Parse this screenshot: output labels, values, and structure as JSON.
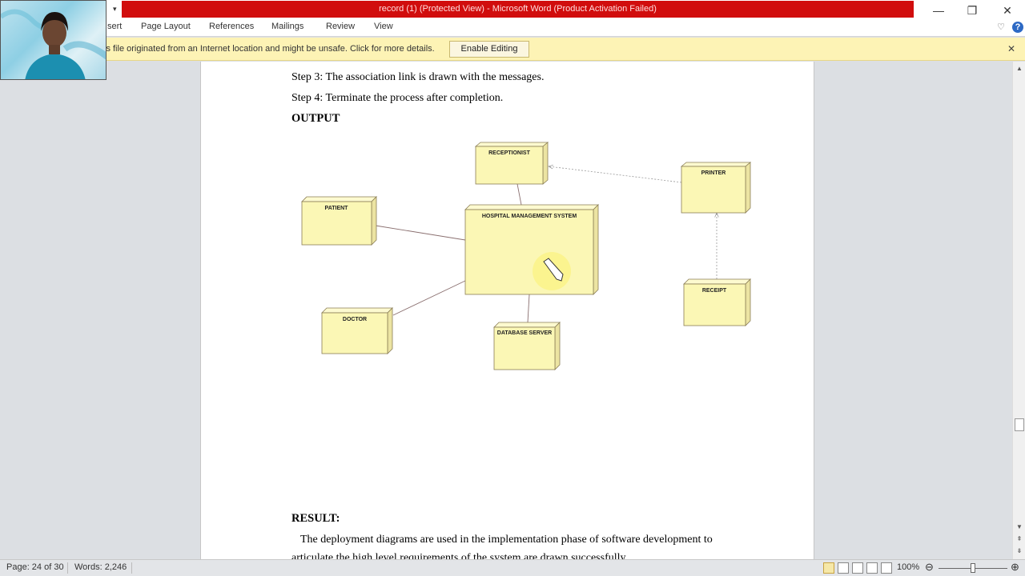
{
  "window": {
    "title": "record (1) (Protected View)  -  Microsoft Word (Product Activation Failed)",
    "minimize_glyph": "—",
    "restore_glyph": "❐",
    "close_glyph": "✕"
  },
  "ribbon": {
    "tabs": [
      "sert",
      "Page Layout",
      "References",
      "Mailings",
      "Review",
      "View"
    ],
    "qat_arrow": "▾",
    "expand_icon": "♡",
    "help_icon": "?"
  },
  "message_bar": {
    "text": "is file originated from an Internet location and might be unsafe. Click for more details.",
    "button": "Enable Editing",
    "close_glyph": "✕"
  },
  "document": {
    "step3": "Step 3: The association link is drawn with the messages.",
    "step4": "Step 4: Terminate  the process after completion.",
    "output_heading": "OUTPUT",
    "result_heading": "RESULT:",
    "result_text": "The  deployment diagrams are used in the implementation  phase of software development to",
    "result_text_2": "articulate the high level requirements of the system are drawn successfully."
  },
  "diagram": {
    "nodes": {
      "receptionist": "RECEPTIONIST",
      "printer": "PRINTER",
      "patient": "PATIENT",
      "hms": "HOSPITAL MANAGEMENT SYSTEM",
      "receipt": "RECEIPT",
      "doctor": "DOCTOR",
      "database": "DATABASE SERVER"
    }
  },
  "scrollbar": {
    "up": "▲",
    "down": "▼",
    "prev": "⇞",
    "next": "⇟"
  },
  "status": {
    "page": "Page: 24 of 30",
    "words": "Words: 2,246",
    "zoom": "100%",
    "zoom_out": "⊖",
    "zoom_in": "⊕"
  },
  "colors": {
    "title_strip": "#d10d0d",
    "message_bar": "#fdf3b5",
    "node_fill": "#fbf7b5",
    "node_border": "#8a7d55"
  }
}
